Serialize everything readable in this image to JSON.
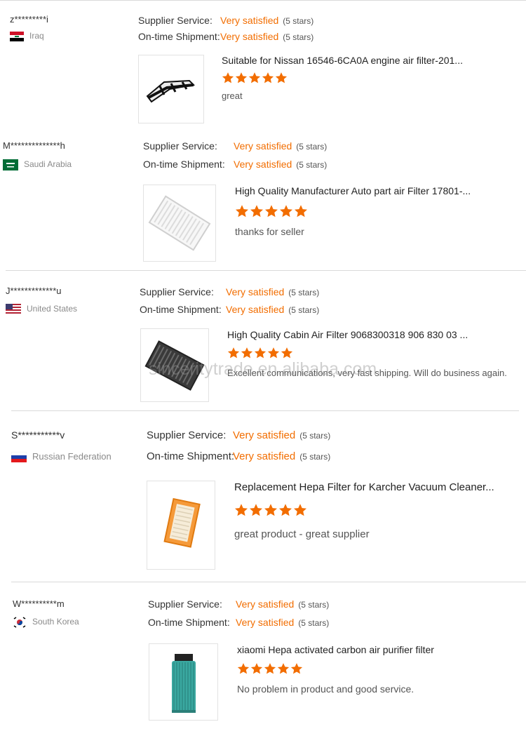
{
  "watermark": "sincerity trade en alibaba com",
  "accent_color": "#f26d00",
  "star_color": "#f26d00",
  "reviews": [
    {
      "user": "z*********i",
      "country": "Iraq",
      "flag_icon": "iraq-flag-icon",
      "supplier_label": "Supplier Service:",
      "supplier_value": "Very satisfied",
      "supplier_stars": "(5 stars)",
      "shipment_label": "On-time Shipment:",
      "shipment_value": "Very satisfied",
      "shipment_stars": "(5 stars)",
      "product_title": "Suitable for Nissan 16546-6CA0A engine air filter-201...",
      "product_icon": "engine-air-filter-image",
      "rating": 5,
      "comment": "great"
    },
    {
      "user": "M**************h",
      "country": "Saudi Arabia",
      "flag_icon": "saudi-arabia-flag-icon",
      "supplier_label": "Supplier Service:",
      "supplier_value": "Very satisfied",
      "supplier_stars": "(5 stars)",
      "shipment_label": "On-time Shipment:",
      "shipment_value": "Very satisfied",
      "shipment_stars": "(5 stars)",
      "product_title": "High Quality Manufacturer Auto part air Filter 17801-...",
      "product_icon": "panel-air-filter-image",
      "rating": 5,
      "comment": "thanks for seller"
    },
    {
      "user": "J*************u",
      "country": "United States",
      "flag_icon": "united-states-flag-icon",
      "supplier_label": "Supplier Service:",
      "supplier_value": "Very satisfied",
      "supplier_stars": "(5 stars)",
      "shipment_label": "On-time Shipment:",
      "shipment_value": "Very satisfied",
      "shipment_stars": "(5 stars)",
      "product_title": "High Quality Cabin Air Filter 9068300318 906 830 03 ...",
      "product_icon": "cabin-air-filter-image",
      "rating": 5,
      "comment": "Excellent communications, very fast shipping. Will do business again."
    },
    {
      "user": "S***********v",
      "country": "Russian Federation",
      "flag_icon": "russia-flag-icon",
      "supplier_label": "Supplier Service:",
      "supplier_value": "Very satisfied",
      "supplier_stars": "(5 stars)",
      "shipment_label": "On-time Shipment:",
      "shipment_value": "Very satisfied",
      "shipment_stars": "(5 stars)",
      "product_title": "Replacement Hepa Filter for Karcher Vacuum Cleaner...",
      "product_icon": "hepa-filter-image",
      "rating": 5,
      "comment": "great product - great supplier"
    },
    {
      "user": "W**********m",
      "country": "South Korea",
      "flag_icon": "south-korea-flag-icon",
      "supplier_label": "Supplier Service:",
      "supplier_value": "Very satisfied",
      "supplier_stars": "(5 stars)",
      "shipment_label": "On-time Shipment:",
      "shipment_value": "Very satisfied",
      "shipment_stars": "(5 stars)",
      "product_title": "xiaomi Hepa activated carbon air purifier filter",
      "product_icon": "air-purifier-filter-image",
      "rating": 5,
      "comment": "No problem in product and good service."
    }
  ]
}
